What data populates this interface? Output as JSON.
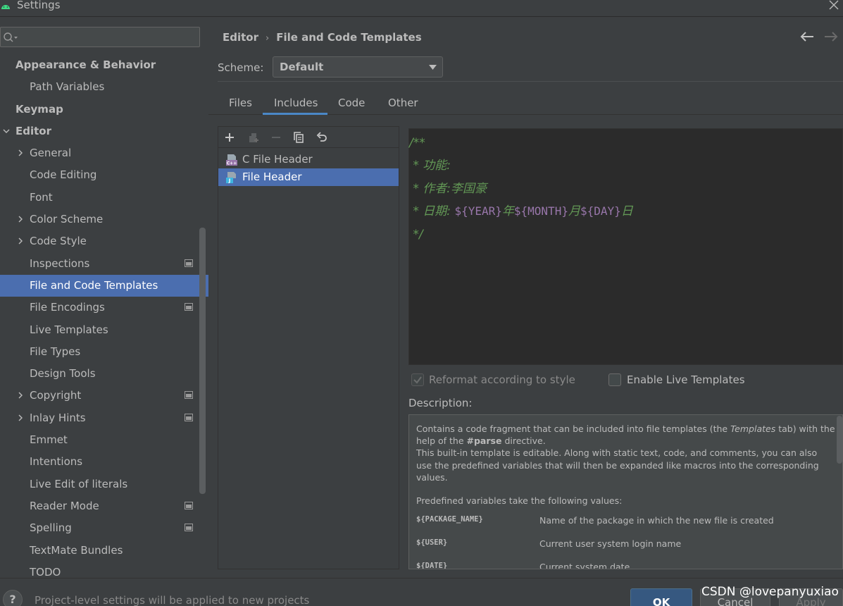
{
  "window": {
    "title": "Settings"
  },
  "search": {
    "placeholder": "",
    "value": ""
  },
  "sidebar": {
    "items": [
      {
        "label": "Appearance & Behavior",
        "level": 0,
        "bold": true,
        "arrow": "none",
        "badge": false,
        "selected": false
      },
      {
        "label": "Path Variables",
        "level": 1,
        "bold": false,
        "arrow": "none",
        "badge": false,
        "selected": false
      },
      {
        "label": "Keymap",
        "level": 0,
        "bold": true,
        "arrow": "none",
        "badge": false,
        "selected": false
      },
      {
        "label": "Editor",
        "level": 0,
        "bold": true,
        "arrow": "down",
        "badge": false,
        "selected": false
      },
      {
        "label": "General",
        "level": 1,
        "bold": false,
        "arrow": "right",
        "badge": false,
        "selected": false
      },
      {
        "label": "Code Editing",
        "level": 1,
        "bold": false,
        "arrow": "none",
        "badge": false,
        "selected": false
      },
      {
        "label": "Font",
        "level": 1,
        "bold": false,
        "arrow": "none",
        "badge": false,
        "selected": false
      },
      {
        "label": "Color Scheme",
        "level": 1,
        "bold": false,
        "arrow": "right",
        "badge": false,
        "selected": false
      },
      {
        "label": "Code Style",
        "level": 1,
        "bold": false,
        "arrow": "right",
        "badge": false,
        "selected": false
      },
      {
        "label": "Inspections",
        "level": 1,
        "bold": false,
        "arrow": "none",
        "badge": true,
        "selected": false
      },
      {
        "label": "File and Code Templates",
        "level": 1,
        "bold": false,
        "arrow": "none",
        "badge": false,
        "selected": true
      },
      {
        "label": "File Encodings",
        "level": 1,
        "bold": false,
        "arrow": "none",
        "badge": true,
        "selected": false
      },
      {
        "label": "Live Templates",
        "level": 1,
        "bold": false,
        "arrow": "none",
        "badge": false,
        "selected": false
      },
      {
        "label": "File Types",
        "level": 1,
        "bold": false,
        "arrow": "none",
        "badge": false,
        "selected": false
      },
      {
        "label": "Design Tools",
        "level": 1,
        "bold": false,
        "arrow": "none",
        "badge": false,
        "selected": false
      },
      {
        "label": "Copyright",
        "level": 1,
        "bold": false,
        "arrow": "right",
        "badge": true,
        "selected": false
      },
      {
        "label": "Inlay Hints",
        "level": 1,
        "bold": false,
        "arrow": "right",
        "badge": true,
        "selected": false
      },
      {
        "label": "Emmet",
        "level": 1,
        "bold": false,
        "arrow": "none",
        "badge": false,
        "selected": false
      },
      {
        "label": "Intentions",
        "level": 1,
        "bold": false,
        "arrow": "none",
        "badge": false,
        "selected": false
      },
      {
        "label": "Live Edit of literals",
        "level": 1,
        "bold": false,
        "arrow": "none",
        "badge": false,
        "selected": false
      },
      {
        "label": "Reader Mode",
        "level": 1,
        "bold": false,
        "arrow": "none",
        "badge": true,
        "selected": false
      },
      {
        "label": "Spelling",
        "level": 1,
        "bold": false,
        "arrow": "none",
        "badge": true,
        "selected": false
      },
      {
        "label": "TextMate Bundles",
        "level": 1,
        "bold": false,
        "arrow": "none",
        "badge": false,
        "selected": false
      },
      {
        "label": "TODO",
        "level": 1,
        "bold": false,
        "arrow": "none",
        "badge": false,
        "selected": false
      }
    ]
  },
  "breadcrumb": {
    "parent": "Editor",
    "separator": "›",
    "current": "File and Code Templates"
  },
  "scheme": {
    "label": "Scheme:",
    "value": "Default"
  },
  "tabs": [
    {
      "label": "Files",
      "active": false
    },
    {
      "label": "Includes",
      "active": true
    },
    {
      "label": "Code",
      "active": false
    },
    {
      "label": "Other",
      "active": false
    }
  ],
  "template_list": {
    "toolbar_icons": [
      "add-icon",
      "add-child-icon",
      "remove-icon",
      "copy-icon",
      "reset-icon"
    ],
    "items": [
      {
        "label": "C File Header",
        "icon": "cpp-file-icon",
        "selected": false
      },
      {
        "label": "File Header",
        "icon": "java-file-icon",
        "selected": true
      }
    ]
  },
  "editor": {
    "lines": [
      [
        {
          "text": "/**",
          "kind": "comment"
        }
      ],
      [
        {
          "text": " * 功能:",
          "kind": "comment"
        }
      ],
      [
        {
          "text": " * 作者:李国豪",
          "kind": "comment"
        }
      ],
      [
        {
          "text": " * 日期: ",
          "kind": "comment"
        },
        {
          "text": "${YEAR}",
          "kind": "var"
        },
        {
          "text": "年",
          "kind": "comment"
        },
        {
          "text": "${MONTH}",
          "kind": "var"
        },
        {
          "text": "月",
          "kind": "comment"
        },
        {
          "text": "${DAY}",
          "kind": "var"
        },
        {
          "text": "日",
          "kind": "comment"
        }
      ],
      [
        {
          "text": " */",
          "kind": "comment"
        }
      ]
    ]
  },
  "options": {
    "reformat": {
      "label": "Reformat according to style",
      "checked": true,
      "enabled": false
    },
    "live_templates": {
      "label": "Enable Live Templates",
      "checked": false,
      "enabled": true
    }
  },
  "description": {
    "label": "Description:",
    "p1_a": "Contains a code fragment that can be included into file templates (the ",
    "p1_em": "Templates",
    "p1_b": " tab) with the help of the ",
    "p1_strong": "#parse",
    "p1_c": " directive.",
    "p2": "This built-in template is editable. Along with static text, code, and comments, you can also use the predefined variables that will then be expanded like macros into the corresponding values.",
    "p3": "Predefined variables take the following values:",
    "variables": [
      {
        "name": "${PACKAGE_NAME}",
        "desc": "Name of the package in which the new file is created"
      },
      {
        "name": "${USER}",
        "desc": "Current user system login name"
      },
      {
        "name": "${DATE}",
        "desc": "Current system date"
      }
    ]
  },
  "footer": {
    "help": "?",
    "note": "Project-level settings will be applied to new projects",
    "ok": "OK",
    "cancel": "Cancel",
    "apply": "Apply",
    "watermark": "CSDN @lovepanyuxiao"
  },
  "colors": {
    "selection": "#4b6eaf",
    "comment": "#629755",
    "template_var": "#9876aa",
    "ok_button": "#365880"
  }
}
